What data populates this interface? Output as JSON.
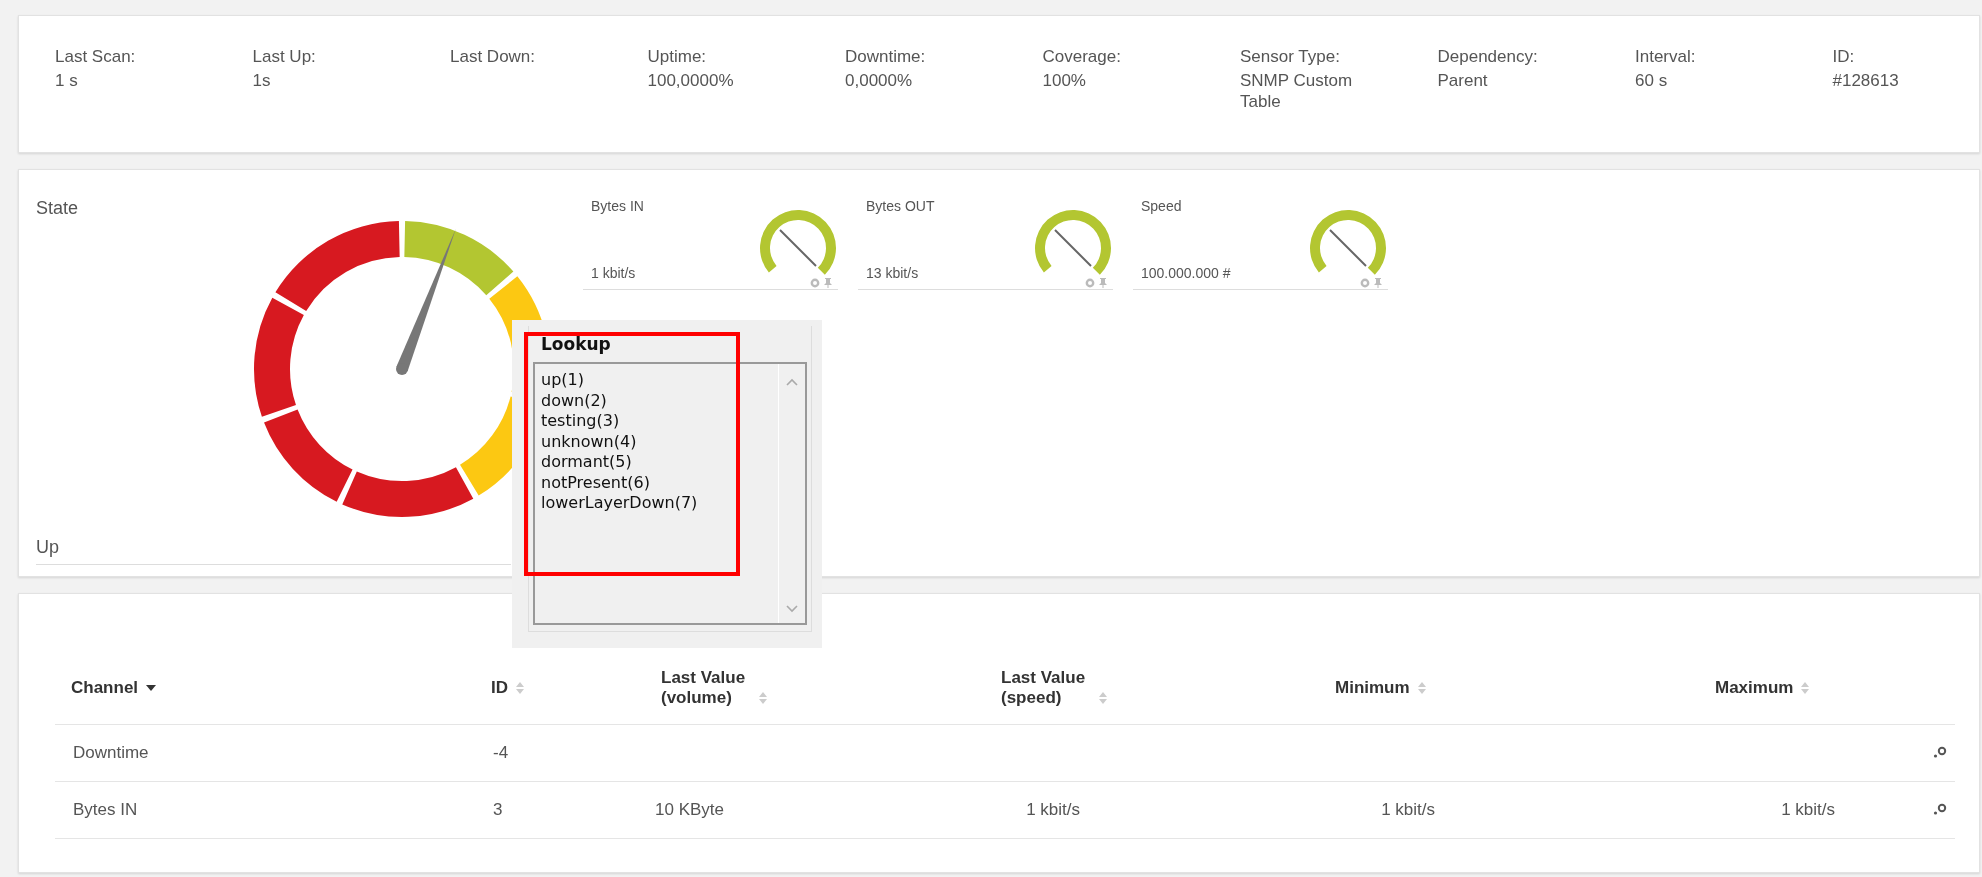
{
  "summary": [
    {
      "label": "Last Scan:",
      "value": "1 s"
    },
    {
      "label": "Last Up:",
      "value": "1s"
    },
    {
      "label": "Last Down:"
    },
    {
      "label": "Uptime:",
      "value": "100,0000%"
    },
    {
      "label": "Downtime:",
      "value": "0,0000%"
    },
    {
      "label": "Coverage:",
      "value": "100%"
    },
    {
      "label": "Sensor Type:",
      "value": "SNMP Custom Table"
    },
    {
      "label": "Dependency:",
      "value": "Parent"
    },
    {
      "label": "Interval:",
      "value": "60 s"
    },
    {
      "label": "ID:",
      "value": "#128613"
    }
  ],
  "state_panel": {
    "title": "State",
    "status": "Up"
  },
  "mini_gauges": [
    {
      "label": "Bytes IN",
      "reading": "1 kbit/s"
    },
    {
      "label": "Bytes OUT",
      "reading": "13 kbit/s"
    },
    {
      "label": "Speed",
      "reading": "100.000.000 #"
    }
  ],
  "lookup_popup": {
    "title": "Lookup",
    "items": [
      "up(1)",
      "down(2)",
      "testing(3)",
      "unknown(4)",
      "dormant(5)",
      "notPresent(6)",
      "lowerLayerDown(7)"
    ]
  },
  "table": {
    "columns": [
      {
        "label": "Channel",
        "sorted": true
      },
      {
        "label": "ID",
        "sorted": false
      },
      {
        "label": "Last Value (volume)",
        "sorted": false
      },
      {
        "label": "Last Value (speed)",
        "sorted": false
      },
      {
        "label": "Minimum",
        "sorted": false
      },
      {
        "label": "Maximum",
        "sorted": false
      }
    ],
    "rows": [
      {
        "cells": [
          "Downtime",
          "-4",
          null,
          null,
          null,
          null
        ]
      },
      {
        "cells": [
          "Bytes IN",
          "3",
          "10 KByte",
          "1 kbit/s",
          "1 kbit/s",
          "1 kbit/s"
        ]
      }
    ]
  }
}
